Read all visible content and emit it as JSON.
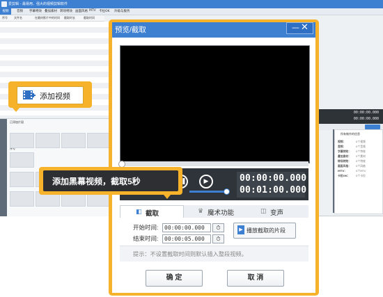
{
  "app": {
    "title": "爱剪辑 - 最易用、强大的视频剪辑软件",
    "menu": [
      "视频",
      "音频",
      "字幕特效",
      "叠加素材",
      "转场特效",
      "画面风格",
      "MTV",
      "卡拉OK",
      "升级与服务"
    ],
    "columns": [
      "序号",
      "文件名",
      "在最终影片中的时间",
      "截取时长",
      "截取时间"
    ],
    "gallery_tab": "已添加片段",
    "gallery_header": "序号",
    "right_times": [
      "00:00:00.000",
      "00:00:00.000"
    ],
    "right_button": "导出视频",
    "right_panel_title": "所有制作的信息",
    "right_panel_rows": [
      {
        "k": "视频：",
        "v": "0个视频"
      },
      {
        "k": "音频：",
        "v": "0个音频"
      },
      {
        "k": "字幕特效：",
        "v": "0个特效"
      },
      {
        "k": "叠加素材：",
        "v": "0个素材"
      },
      {
        "k": "转场特效：",
        "v": "0个特效"
      },
      {
        "k": "画面风格：",
        "v": "0个风格"
      },
      {
        "k": "MTV：",
        "v": "0个MTV"
      },
      {
        "k": "卡拉OK：",
        "v": "0个卡拉"
      }
    ]
  },
  "callout_add": {
    "label": "添加视频"
  },
  "callout_note": {
    "text": "添加黑幕视频，截取5秒"
  },
  "dialog": {
    "title": "预览/截取",
    "minimize": "—",
    "close": "✕",
    "time_current": "00:00:00.000",
    "time_total": "00:01:00.000",
    "tabs": [
      {
        "label": "截取",
        "icon": "◧"
      },
      {
        "label": "魔术功能",
        "icon": "♛"
      },
      {
        "label": "变声",
        "icon": "◫"
      }
    ],
    "start_label": "开始时间:",
    "start_value": "00:00:00.000",
    "end_label": "结束时间:",
    "end_value": "00:00:05.000",
    "play_cut_label": "播放截取的片段",
    "hint": "提示：不设置截取时间则默认插入整段视频。",
    "ok": "确 定",
    "cancel": "取 消"
  }
}
